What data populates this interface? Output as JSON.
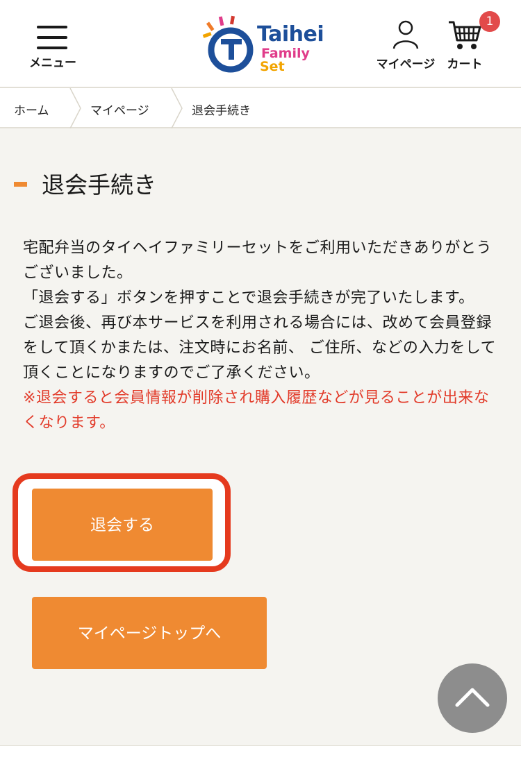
{
  "header": {
    "menu_label": "メニュー",
    "logo": {
      "line1": "Taihei",
      "line2": "Family",
      "line3": "Set"
    },
    "mypage_label": "マイページ",
    "cart_label": "カート",
    "cart_count": "1"
  },
  "breadcrumb": {
    "items": [
      "ホーム",
      "マイページ",
      "退会手続き"
    ]
  },
  "main": {
    "title": "退会手続き",
    "paragraphs": [
      "宅配弁当のタイヘイファミリーセットをご利用いただきありがとうございました。",
      "「退会する」ボタンを押すことで退会手続きが完了いたします。",
      "ご退会後、再び本サービスを利用される場合には、改めて会員登録をして頂くかまたは、注文時にお名前、 ご住所、などの入力をして頂くことになりますのでご了承ください。"
    ],
    "warning": "※退会すると会員情報が削除され購入履歴などが見ることが出来なくなります。",
    "withdraw_button": "退会する",
    "mypage_top_button": "マイページトップへ"
  },
  "colors": {
    "accent": "#ef8a32",
    "highlight": "#e53a1e",
    "warning": "#e23b2a",
    "badge": "#e24a4a",
    "logo_blue": "#1d4f9a"
  },
  "icons": {
    "menu": "hamburger-icon",
    "mypage": "user-icon",
    "cart": "cart-icon",
    "scroll_top": "chevron-up-icon"
  }
}
